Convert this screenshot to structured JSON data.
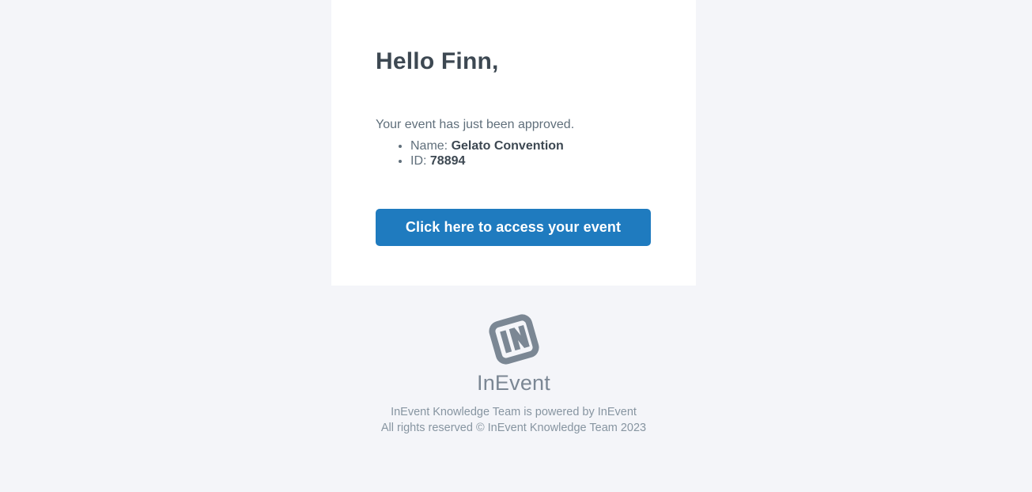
{
  "theme": {
    "page_background": "#f4f5f9",
    "card_background": "#ffffff",
    "heading_color": "#3d4852",
    "body_color": "#606f7b",
    "button_color": "#1f7bbf",
    "button_text_color": "#ffffff",
    "footer_color": "#8795a1",
    "logo_color": "#7b8794"
  },
  "email": {
    "greeting": "Hello Finn,",
    "intro": "Your event has just been approved.",
    "details": [
      {
        "label": "Name:",
        "value": "Gelato Convention"
      },
      {
        "label": "ID:",
        "value": "78894"
      }
    ],
    "cta_label": "Click here to access your event"
  },
  "footer": {
    "logo_icon": "inevent-logo-icon",
    "brand_name": "InEvent",
    "powered_by_line": "InEvent Knowledge Team is powered by InEvent",
    "rights_line": "All rights reserved © InEvent Knowledge Team 2023"
  }
}
